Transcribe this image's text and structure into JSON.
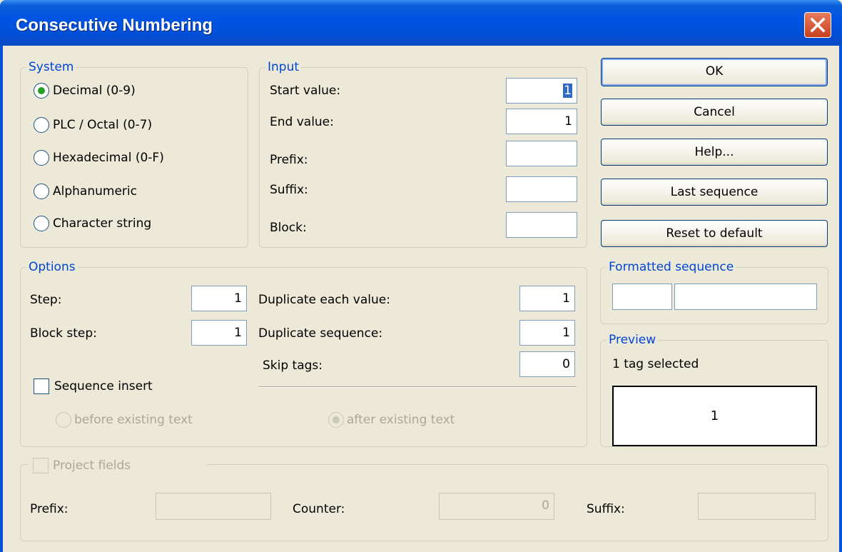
{
  "window": {
    "title": "Consecutive Numbering",
    "close_icon": "close-icon"
  },
  "system": {
    "legend": "System",
    "options": [
      {
        "label": "Decimal (0-9)",
        "selected": true
      },
      {
        "label": "PLC / Octal (0-7)",
        "selected": false
      },
      {
        "label": "Hexadecimal (0-F)",
        "selected": false
      },
      {
        "label": "Alphanumeric",
        "selected": false
      },
      {
        "label": "Character string",
        "selected": false
      }
    ]
  },
  "input": {
    "legend": "Input",
    "start_label": "Start value:",
    "start_value": "1",
    "end_label": "End value:",
    "end_value": "1",
    "prefix_label": "Prefix:",
    "prefix_value": "",
    "suffix_label": "Suffix:",
    "suffix_value": "",
    "block_label": "Block:",
    "block_value": ""
  },
  "buttons": {
    "ok": "OK",
    "cancel": "Cancel",
    "help": "Help...",
    "last_sequence": "Last sequence",
    "reset": "Reset to default"
  },
  "options": {
    "legend": "Options",
    "step_label": "Step:",
    "step_value": "1",
    "block_step_label": "Block step:",
    "block_step_value": "1",
    "dup_each_label": "Duplicate each value:",
    "dup_each_value": "1",
    "dup_seq_label": "Duplicate sequence:",
    "dup_seq_value": "1",
    "skip_label": "Skip tags:",
    "skip_value": "0",
    "sequence_insert_label": "Sequence insert",
    "sequence_insert_checked": false,
    "before_label": "before existing text",
    "after_label": "after existing text",
    "after_selected": true
  },
  "formatted": {
    "legend": "Formatted sequence",
    "left": "",
    "right": ""
  },
  "preview": {
    "legend": "Preview",
    "status": "1 tag selected",
    "value": "1"
  },
  "project": {
    "label": "Project fields",
    "checked": false,
    "prefix_label": "Prefix:",
    "prefix_value": "",
    "counter_label": "Counter:",
    "counter_value": "0",
    "suffix_label": "Suffix:",
    "suffix_value": ""
  },
  "colors": {
    "titlebar": "#0054e3",
    "legend": "#0046d5",
    "dialog_bg": "#ece9d8",
    "radio_dot": "#21a121"
  }
}
